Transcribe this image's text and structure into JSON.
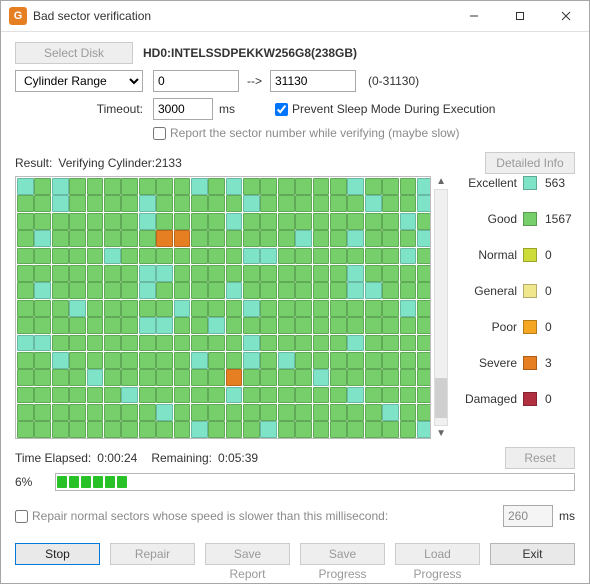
{
  "window": {
    "title": "Bad sector verification"
  },
  "toolbar": {
    "select_disk_label": "Select Disk",
    "disk_name": "HD0:INTELSSDPEKKW256G8(238GB)",
    "range_label": "Cylinder Range",
    "range_start": "0",
    "range_arrow": "-->",
    "range_end": "31130",
    "range_hint": "(0-31130)",
    "timeout_label": "Timeout:",
    "timeout_value": "3000",
    "timeout_unit": "ms",
    "prevent_sleep_label": "Prevent Sleep Mode During Execution",
    "prevent_sleep_checked": true,
    "report_sector_label": "Report the sector number while verifying (maybe slow)",
    "report_sector_checked": false
  },
  "result": {
    "prefix": "Result:",
    "status": "Verifying Cylinder:2133",
    "detailed_info_label": "Detailed Info"
  },
  "grid": {
    "cols": 24,
    "rows": 15,
    "total": 360,
    "colors": {
      "excellent": "#7fe3c8",
      "good": "#76cf6a",
      "normal": "#cddc39",
      "general": "#f0e68c",
      "poor": "#f5a623",
      "severe": "#e67e22",
      "damaged": "#b03040"
    },
    "severe_cells": [
      80,
      81,
      276
    ],
    "excellent_cells": [
      0,
      2,
      10,
      23,
      26,
      31,
      44,
      47,
      55,
      70,
      88,
      95,
      101,
      110,
      128,
      139,
      151,
      164,
      177,
      190,
      203,
      216,
      229,
      242,
      255,
      268,
      281,
      294,
      307,
      320,
      333,
      346,
      359,
      145,
      156,
      171,
      12,
      60,
      118,
      200,
      250,
      300,
      350,
      19,
      37,
      73,
      91,
      109,
      127,
      163,
      181,
      199,
      217,
      235,
      253
    ]
  },
  "legend": {
    "items": [
      {
        "name": "Excellent",
        "color_key": "excellent",
        "count": 563
      },
      {
        "name": "Good",
        "color_key": "good",
        "count": 1567
      },
      {
        "name": "Normal",
        "color_key": "normal",
        "count": 0
      },
      {
        "name": "General",
        "color_key": "general",
        "count": 0
      },
      {
        "name": "Poor",
        "color_key": "poor",
        "count": 0
      },
      {
        "name": "Severe",
        "color_key": "severe",
        "count": 3
      },
      {
        "name": "Damaged",
        "color_key": "damaged",
        "count": 0
      }
    ]
  },
  "progress": {
    "elapsed_label": "Time Elapsed:",
    "elapsed_value": "0:00:24",
    "remaining_label": "Remaining:",
    "remaining_value": "0:05:39",
    "reset_label": "Reset",
    "percent_text": "6%",
    "percent": 6
  },
  "repair_row": {
    "label": "Repair normal sectors whose speed is slower than this millisecond:",
    "checked": false,
    "value": "260",
    "unit": "ms"
  },
  "buttons": {
    "stop": "Stop",
    "repair": "Repair",
    "save_report": "Save Report",
    "save_progress": "Save Progress",
    "load_progress": "Load Progress",
    "exit": "Exit"
  }
}
